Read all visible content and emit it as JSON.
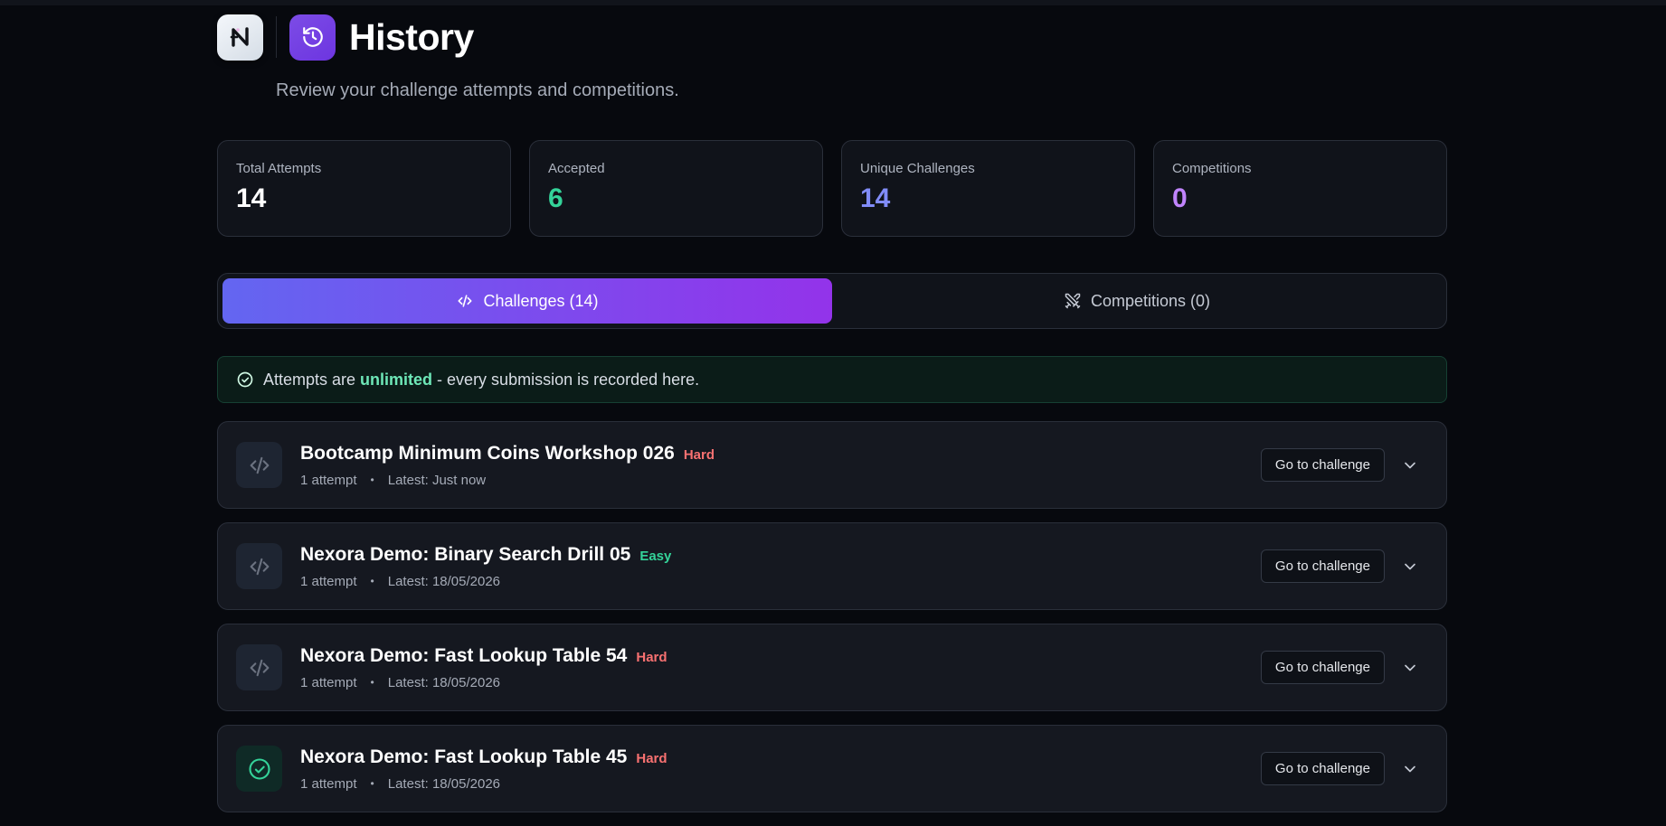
{
  "header": {
    "title": "History",
    "subtitle": "Review your challenge attempts and competitions."
  },
  "stats": [
    {
      "label": "Total Attempts",
      "value": "14",
      "color": "#ffffff"
    },
    {
      "label": "Accepted",
      "value": "6",
      "color": "#34d399"
    },
    {
      "label": "Unique Challenges",
      "value": "14",
      "color": "#818cf8"
    },
    {
      "label": "Competitions",
      "value": "0",
      "color": "#c084fc"
    }
  ],
  "tabs": [
    {
      "label": "Challenges (14)",
      "icon": "code-icon",
      "active": true
    },
    {
      "label": "Competitions (0)",
      "icon": "swords-icon",
      "active": false
    }
  ],
  "notice": {
    "prefix": "Attempts are ",
    "highlight": "unlimited",
    "suffix": " - every submission is recorded here."
  },
  "items": [
    {
      "title": "Bootcamp Minimum Coins Workshop 026",
      "difficulty": "Hard",
      "attempts": "1 attempt",
      "latest": "Latest: Just now",
      "icon": "code-icon",
      "button": "Go to challenge"
    },
    {
      "title": "Nexora Demo: Binary Search Drill 05",
      "difficulty": "Easy",
      "attempts": "1 attempt",
      "latest": "Latest: 18/05/2026",
      "icon": "code-icon",
      "button": "Go to challenge"
    },
    {
      "title": "Nexora Demo: Fast Lookup Table 54",
      "difficulty": "Hard",
      "attempts": "1 attempt",
      "latest": "Latest: 18/05/2026",
      "icon": "code-icon",
      "button": "Go to challenge"
    },
    {
      "title": "Nexora Demo: Fast Lookup Table 45",
      "difficulty": "Hard",
      "attempts": "1 attempt",
      "latest": "Latest: 18/05/2026",
      "icon": "check-circle-icon",
      "button": "Go to challenge"
    }
  ],
  "colors": {
    "accent_start": "#6366f1",
    "accent_end": "#9333ea",
    "hard": "#f87171",
    "easy": "#34d399"
  }
}
